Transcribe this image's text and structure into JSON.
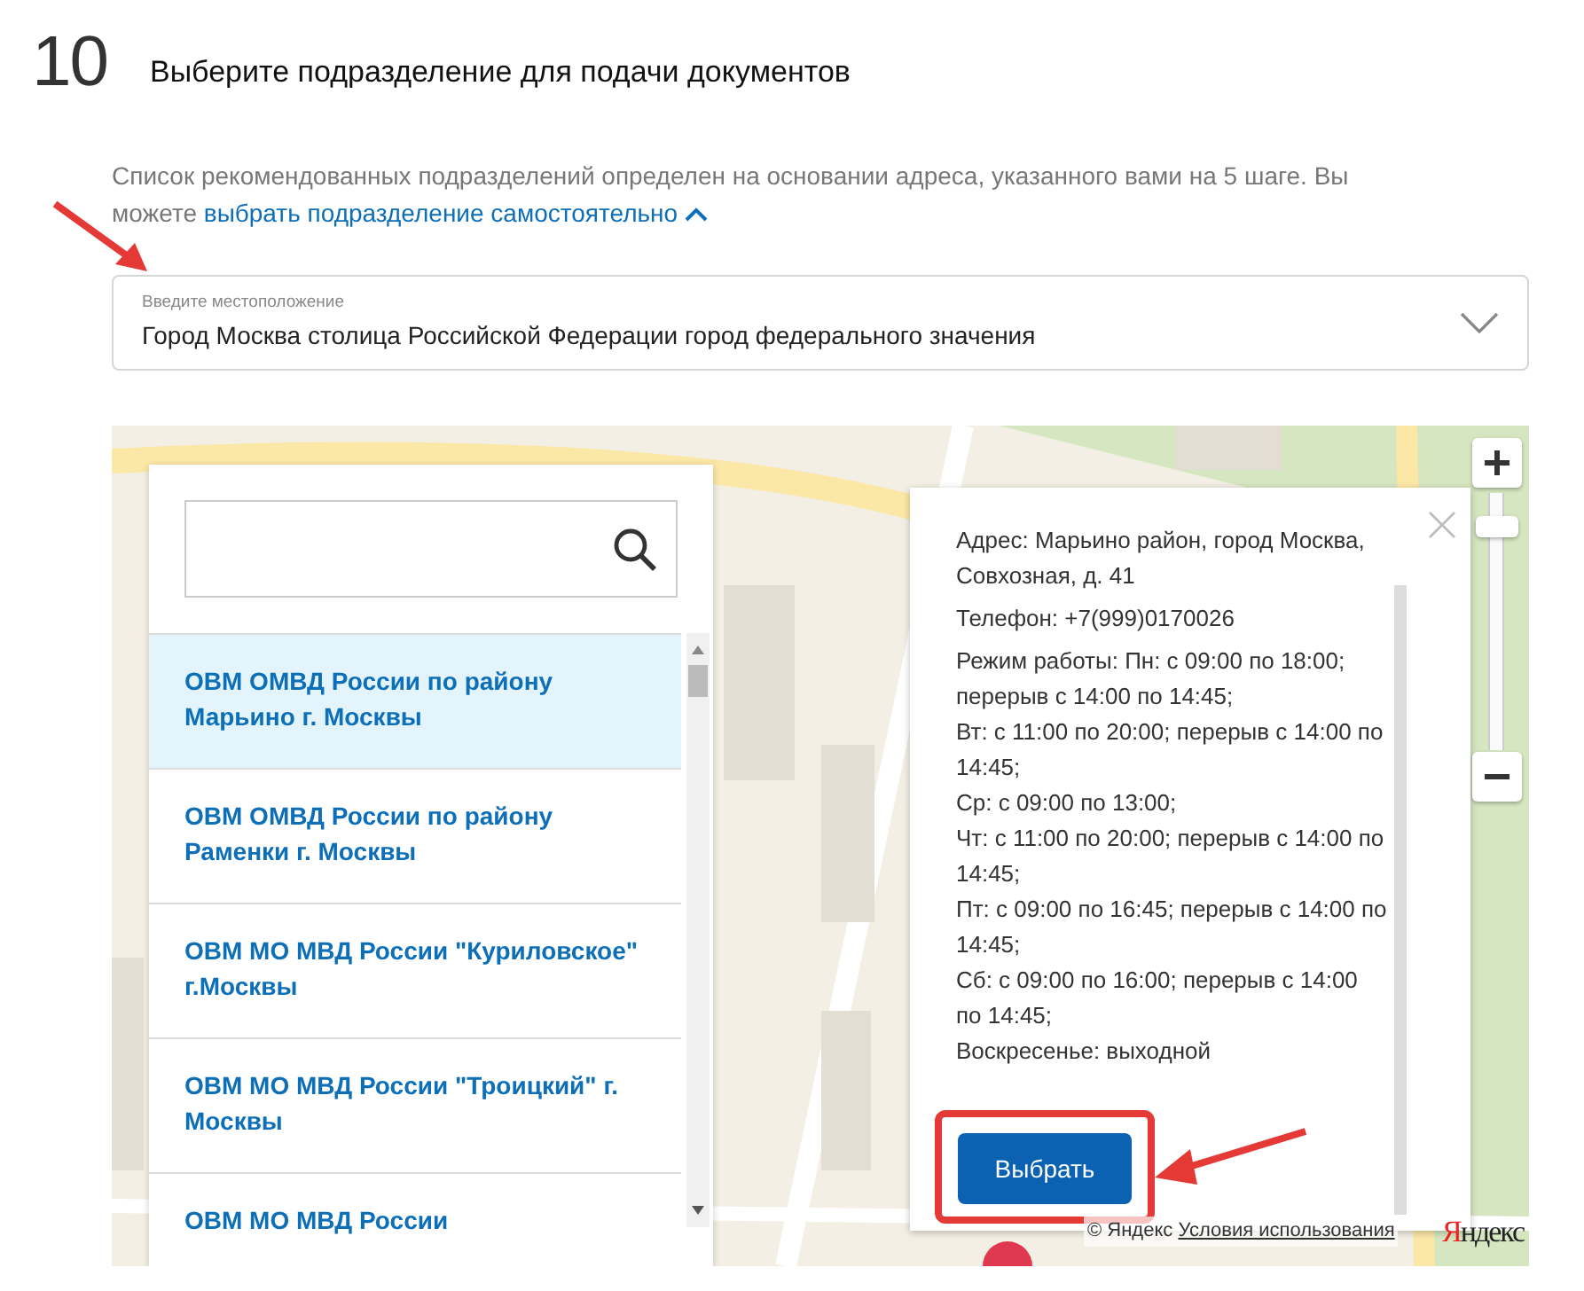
{
  "step": {
    "number": "10",
    "title": "Выберите подразделение для подачи документов"
  },
  "intro": {
    "text": "Список рекомендованных подразделений определен на основании адреса, указанного вами на 5 шаге. Вы можете",
    "link": "выбрать подразделение самостоятельно",
    "expanded": true
  },
  "location_field": {
    "label": "Введите местоположение",
    "value": "Город Москва столица Российской Федерации город федерального значения"
  },
  "map": {
    "kind": "picture",
    "zoom": {
      "level": 0.9
    },
    "list": {
      "items": [
        {
          "name": "ОВМ ОМВД России по району Марьино г. Москвы",
          "selected": true
        },
        {
          "name": "ОВМ ОМВД России по району Раменки г. Москвы",
          "selected": false
        },
        {
          "name": "ОВМ МО МВД России \"Куриловское\" г.Москвы",
          "selected": false
        },
        {
          "name": "ОВМ МО МВД России \"Троицкий\" г. Москвы",
          "selected": false
        },
        {
          "name": "ОВМ МО МВД России",
          "selected": false
        }
      ]
    },
    "popup": {
      "address": "Адрес: Марьино район, город Москва, Совхозная, д. 41",
      "phone": "Телефон: +7(999)0170026",
      "hours": [
        "Режим работы: Пн: с 09:00 по 18:00; перерыв с 14:00 по 14:45;",
        "Вт: с 11:00 по 20:00; перерыв с 14:00 по 14:45;",
        "Ср: с 09:00 по 13:00;",
        "Чт: с 11:00 по 20:00; перерыв с 14:00 по 14:45;",
        "Пт: с 09:00 по 16:45; перерыв с 14:00 по 14:45;",
        "Сб: с 09:00 по 16:00; перерыв с 14:00 по 14:45;",
        "Воскресенье: выходной"
      ],
      "button": "Выбрать"
    },
    "copyright": "© Яндекс",
    "terms_link": "Условия использования",
    "logo": "Яндекс"
  }
}
